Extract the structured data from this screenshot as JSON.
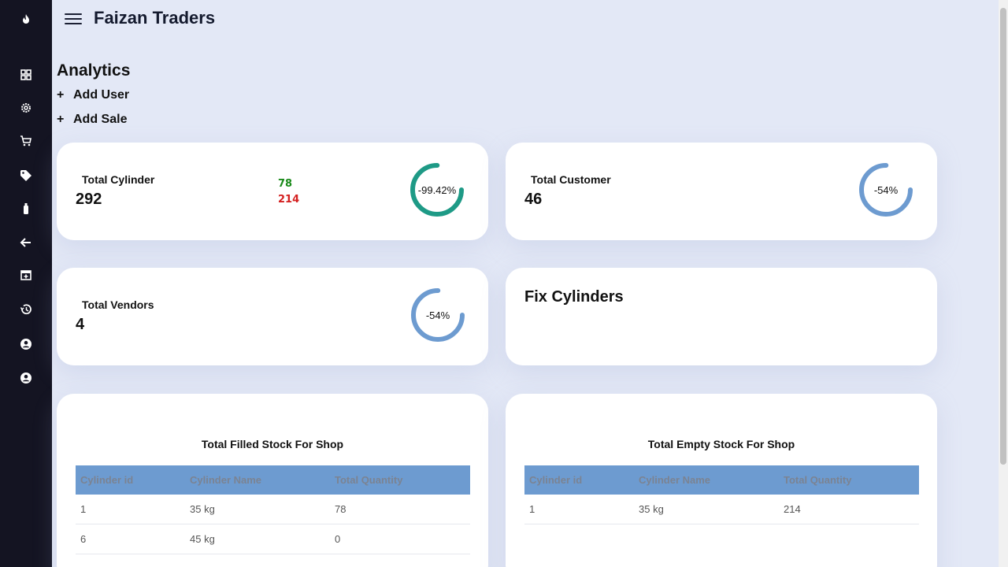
{
  "app": {
    "title": "Faizan Traders"
  },
  "sidebar": {
    "icons": [
      "flame-icon",
      "dashboard-icon",
      "settings-icon",
      "cart-icon",
      "tag-icon",
      "cylinder-icon",
      "back-arrow-icon",
      "calendar-add-icon",
      "history-icon",
      "account-icon",
      "account-icon"
    ]
  },
  "page": {
    "title": "Analytics"
  },
  "actions": {
    "add_user": "Add User",
    "add_sale": "Add Sale",
    "plus": "+"
  },
  "cards": {
    "total_cylinder": {
      "label": "Total Cylinder",
      "value": "292",
      "filled": "78",
      "empty": "214",
      "ring_text": "-99.42%",
      "ring_fraction": 0.75,
      "ring_color": "#1e9a86"
    },
    "total_customer": {
      "label": "Total Customer",
      "value": "46",
      "ring_text": "-54%",
      "ring_fraction": 0.75,
      "ring_color": "#6d9bd0"
    },
    "total_vendors": {
      "label": "Total Vendors",
      "value": "4",
      "ring_text": "-54%",
      "ring_fraction": 0.75,
      "ring_color": "#6d9bd0"
    },
    "fix_cylinders": {
      "title": "Fix Cylinders"
    }
  },
  "tables": {
    "filled": {
      "title": "Total Filled Stock For Shop",
      "headers": [
        "Cylinder id",
        "Cylinder Name",
        "Total Quantity"
      ],
      "rows": [
        [
          "1",
          "35 kg",
          "78"
        ],
        [
          "6",
          "45 kg",
          "0"
        ]
      ]
    },
    "empty": {
      "title": "Total Empty Stock For Shop",
      "headers": [
        "Cylinder id",
        "Cylinder Name",
        "Total Quantity"
      ],
      "rows": [
        [
          "1",
          "35 kg",
          "214"
        ]
      ]
    }
  },
  "colors": {
    "sidebar_bg": "#141422",
    "page_bg": "#e3e8f6",
    "header_blue": "#6d9bd0",
    "teal": "#1e9a86",
    "green": "#1a8a1a",
    "red": "#d42020"
  }
}
